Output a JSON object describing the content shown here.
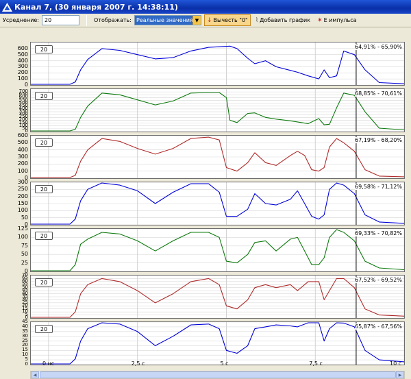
{
  "window": {
    "title": "Канал 7, (30 января 2007 г. 14:38:11)",
    "icon": "app-logo-icon"
  },
  "toolbar": {
    "averaging_label": "Усреднение:",
    "averaging_value": "20",
    "display_label": "Отображать:",
    "display_value": "Реальные значения",
    "subtract_zero_label": "Вычесть \"0\"",
    "add_graph_label": "Добавить график",
    "sum_pulse_label": "Е импульса"
  },
  "time_axis": {
    "unit": "с",
    "range": [
      -0.5,
      10
    ],
    "ticks": [
      "0 нс",
      "2,5 с",
      "5 с",
      "7,5 с",
      "10 с"
    ],
    "tick_values": [
      0,
      2.5,
      5,
      7.5,
      10
    ],
    "cursor": 8.65
  },
  "colors": {
    "blue": "#0000d8",
    "green": "#0d7a0d",
    "red": "#b02a2a",
    "cursor": "#000000"
  },
  "chart_data": [
    {
      "type": "line",
      "color": "blue",
      "ylim": [
        0,
        700
      ],
      "yticks": [
        0,
        100,
        200,
        300,
        400,
        500,
        600
      ],
      "averaging": "20",
      "percent_range": "64,91% - 65,90%",
      "x": [
        -0.5,
        0.6,
        0.75,
        0.9,
        1.1,
        1.5,
        2.0,
        2.5,
        3.0,
        3.5,
        4.0,
        4.5,
        4.8,
        5.1,
        5.3,
        5.6,
        5.8,
        6.1,
        6.4,
        6.8,
        7.0,
        7.3,
        7.6,
        7.75,
        7.9,
        8.1,
        8.3,
        8.6,
        8.9,
        9.3,
        10
      ],
      "values": [
        0,
        0,
        50,
        250,
        420,
        600,
        570,
        500,
        430,
        450,
        560,
        620,
        630,
        640,
        600,
        440,
        350,
        400,
        300,
        240,
        210,
        150,
        100,
        250,
        120,
        150,
        560,
        500,
        250,
        40,
        20
      ]
    },
    {
      "type": "line",
      "color": "green",
      "ylim": [
        0,
        750
      ],
      "yticks": [
        0,
        50,
        100,
        150,
        200,
        250,
        300,
        350,
        400,
        450,
        500,
        550,
        600,
        650,
        700
      ],
      "averaging": "20",
      "percent_range": "68,85% - 70,61%",
      "x": [
        -0.5,
        0.6,
        0.75,
        0.9,
        1.1,
        1.5,
        2.0,
        2.5,
        3.0,
        3.5,
        4.0,
        4.5,
        4.8,
        5.0,
        5.1,
        5.3,
        5.6,
        5.8,
        6.1,
        6.4,
        6.8,
        7.0,
        7.3,
        7.6,
        7.75,
        7.9,
        8.1,
        8.3,
        8.6,
        8.9,
        9.3,
        10
      ],
      "values": [
        0,
        0,
        40,
        250,
        450,
        680,
        650,
        560,
        470,
        540,
        680,
        690,
        690,
        600,
        200,
        160,
        320,
        330,
        250,
        220,
        190,
        170,
        140,
        230,
        120,
        130,
        420,
        680,
        640,
        350,
        60,
        30
      ]
    },
    {
      "type": "line",
      "color": "red",
      "ylim": [
        0,
        600
      ],
      "yticks": [
        0,
        100,
        200,
        300,
        400,
        500,
        600
      ],
      "averaging": "20",
      "percent_range": "67,19% - 68,20%",
      "x": [
        -0.5,
        0.6,
        0.75,
        0.9,
        1.1,
        1.5,
        2.0,
        2.5,
        3.0,
        3.5,
        4.0,
        4.5,
        4.8,
        5.0,
        5.3,
        5.6,
        5.8,
        6.1,
        6.4,
        6.8,
        7.0,
        7.2,
        7.4,
        7.6,
        7.75,
        7.9,
        8.1,
        8.3,
        8.6,
        8.9,
        9.3,
        10
      ],
      "values": [
        0,
        0,
        40,
        240,
        400,
        560,
        520,
        420,
        340,
        420,
        560,
        580,
        540,
        150,
        100,
        220,
        360,
        220,
        180,
        320,
        380,
        320,
        120,
        100,
        150,
        440,
        560,
        500,
        380,
        120,
        30,
        20
      ]
    },
    {
      "type": "line",
      "color": "blue",
      "ylim": [
        0,
        300
      ],
      "yticks": [
        0,
        50,
        100,
        150,
        200,
        250,
        300
      ],
      "averaging": "20",
      "percent_range": "69,58% - 71,12%",
      "x": [
        -0.5,
        0.6,
        0.75,
        0.9,
        1.1,
        1.5,
        2.0,
        2.5,
        3.0,
        3.5,
        4.0,
        4.5,
        4.8,
        5.0,
        5.3,
        5.6,
        5.8,
        6.1,
        6.4,
        6.8,
        7.0,
        7.2,
        7.4,
        7.6,
        7.75,
        7.9,
        8.1,
        8.3,
        8.6,
        8.9,
        9.3,
        10
      ],
      "values": [
        0,
        0,
        40,
        170,
        250,
        300,
        280,
        240,
        150,
        230,
        290,
        290,
        230,
        60,
        60,
        110,
        220,
        150,
        140,
        180,
        240,
        150,
        60,
        40,
        70,
        250,
        300,
        280,
        220,
        70,
        20,
        10
      ]
    },
    {
      "type": "line",
      "color": "green",
      "ylim": [
        0,
        125
      ],
      "yticks": [
        0,
        25,
        50,
        75,
        100,
        125
      ],
      "averaging": "20",
      "percent_range": "69,33% - 70,82%",
      "x": [
        -0.5,
        0.6,
        0.75,
        0.9,
        1.1,
        1.5,
        2.0,
        2.5,
        3.0,
        3.5,
        4.0,
        4.5,
        4.8,
        5.0,
        5.3,
        5.6,
        5.8,
        6.1,
        6.4,
        6.8,
        7.0,
        7.2,
        7.4,
        7.6,
        7.75,
        7.9,
        8.1,
        8.3,
        8.6,
        8.9,
        9.3,
        10
      ],
      "values": [
        0,
        0,
        20,
        80,
        95,
        115,
        110,
        90,
        60,
        90,
        115,
        115,
        100,
        30,
        25,
        50,
        85,
        90,
        60,
        95,
        100,
        60,
        20,
        20,
        40,
        100,
        125,
        115,
        90,
        30,
        10,
        5
      ]
    },
    {
      "type": "line",
      "color": "red",
      "ylim": [
        0,
        70
      ],
      "yticks": [
        0,
        5,
        10,
        15,
        20,
        25,
        30,
        35,
        40,
        45,
        50,
        55,
        60,
        65,
        70
      ],
      "averaging": "20",
      "percent_range": "67,52% - 69,52%",
      "x": [
        -0.5,
        0.6,
        0.75,
        0.9,
        1.1,
        1.5,
        2.0,
        2.5,
        3.0,
        3.5,
        4.0,
        4.5,
        4.8,
        5.0,
        5.3,
        5.6,
        5.8,
        6.1,
        6.4,
        6.8,
        7.0,
        7.3,
        7.6,
        7.75,
        7.9,
        8.1,
        8.3,
        8.6,
        8.9,
        9.3,
        10
      ],
      "values": [
        0,
        0,
        10,
        40,
        55,
        65,
        60,
        45,
        25,
        40,
        60,
        65,
        55,
        20,
        15,
        30,
        50,
        55,
        50,
        55,
        45,
        60,
        60,
        30,
        45,
        65,
        65,
        50,
        15,
        5,
        3
      ]
    },
    {
      "type": "line",
      "color": "blue",
      "ylim": [
        0,
        45
      ],
      "yticks": [
        0,
        5,
        10,
        15,
        20,
        25,
        30,
        35,
        40,
        45
      ],
      "averaging": "20",
      "percent_range": "65,87% - 67,56%",
      "x": [
        -0.5,
        0.6,
        0.75,
        0.9,
        1.1,
        1.5,
        2.0,
        2.5,
        3.0,
        3.5,
        4.0,
        4.5,
        4.8,
        5.0,
        5.3,
        5.6,
        5.8,
        6.1,
        6.4,
        6.8,
        7.0,
        7.3,
        7.6,
        7.75,
        7.9,
        8.1,
        8.3,
        8.6,
        8.9,
        9.3,
        10
      ],
      "values": [
        0,
        0,
        6,
        25,
        38,
        45,
        43,
        35,
        20,
        30,
        42,
        43,
        38,
        15,
        12,
        20,
        38,
        40,
        42,
        41,
        40,
        45,
        45,
        25,
        38,
        45,
        44,
        40,
        15,
        5,
        3
      ]
    }
  ]
}
